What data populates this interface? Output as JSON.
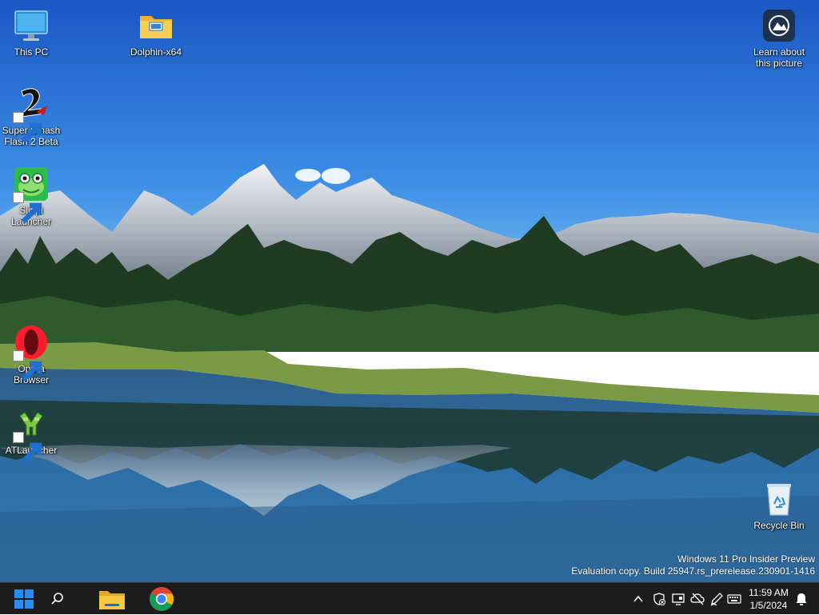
{
  "desktop": {
    "icons": [
      {
        "label": "This PC",
        "icon": "monitor-icon"
      },
      {
        "label": "Dolphin-x64",
        "icon": "folder-icon"
      },
      {
        "label": "Learn about this picture",
        "icon": "camera-info-icon"
      },
      {
        "label": "Super Smash Flash 2 Beta",
        "icon": "ssf2-icon",
        "shortcut": true
      },
      {
        "label": "Slippi Launcher",
        "icon": "frog-icon",
        "shortcut": true
      },
      {
        "label": "Opera Browser",
        "icon": "opera-icon",
        "shortcut": true
      },
      {
        "label": "ATLauncher",
        "icon": "atlauncher-icon",
        "shortcut": true
      },
      {
        "label": "Recycle Bin",
        "icon": "recycle-bin-icon"
      }
    ]
  },
  "watermark": {
    "line1": "Windows 11 Pro Insider Preview",
    "line2": "Evaluation copy. Build 25947.rs_prerelease.230901-1416"
  },
  "taskbar": {
    "pinned": [
      "start-icon",
      "search-icon",
      "file-explorer-icon",
      "chrome-icon"
    ],
    "tray": [
      "chevron-up-icon",
      "security-icon",
      "display-icon",
      "cloud-icon",
      "pen-icon",
      "keyboard-icon",
      "notifications-bell-icon"
    ],
    "time": "11:59 AM",
    "date": "1/5/2024"
  },
  "colors": {
    "sky_top": "#1d5fc6",
    "sky_bottom": "#5aa8e8",
    "taskbar": "#1c1c1c",
    "start_blue": "#2a8cf0"
  }
}
